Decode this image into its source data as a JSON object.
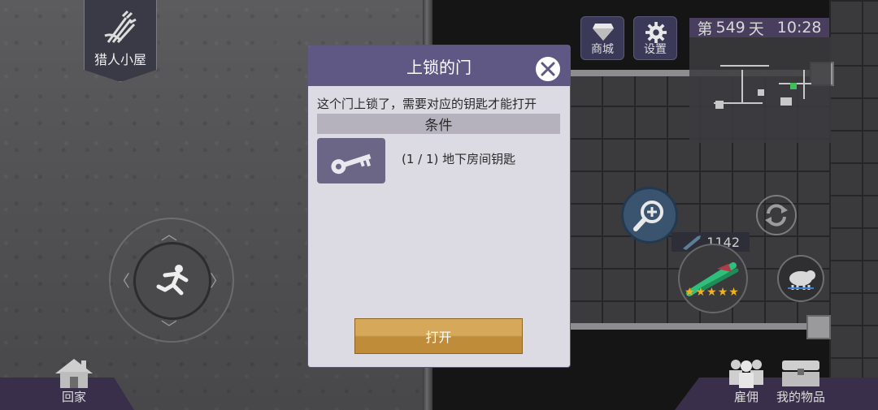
{
  "hud": {
    "home_badge_label": "猎人小屋",
    "shop_label": "商城",
    "settings_label": "设置",
    "day_prefix": "第",
    "day_number": "549",
    "day_suffix": "天",
    "time": "10:28",
    "go_home_label": "回家",
    "hire_label": "雇佣",
    "inventory_label": "我的物品",
    "weapon_power": "1142",
    "weapon_stars": 5
  },
  "dialog": {
    "title": "上锁的门",
    "description": "这个门上锁了，需要对应的钥匙才能打开",
    "condition_header": "条件",
    "requirement_text": "(1 / 1) 地下房间钥匙",
    "open_button": "打开"
  },
  "colors": {
    "dialog_header": "#5f5784",
    "dialog_body": "#dcdae2",
    "open_button": "#c99a48",
    "hud_panel": "#3a2f4a"
  }
}
